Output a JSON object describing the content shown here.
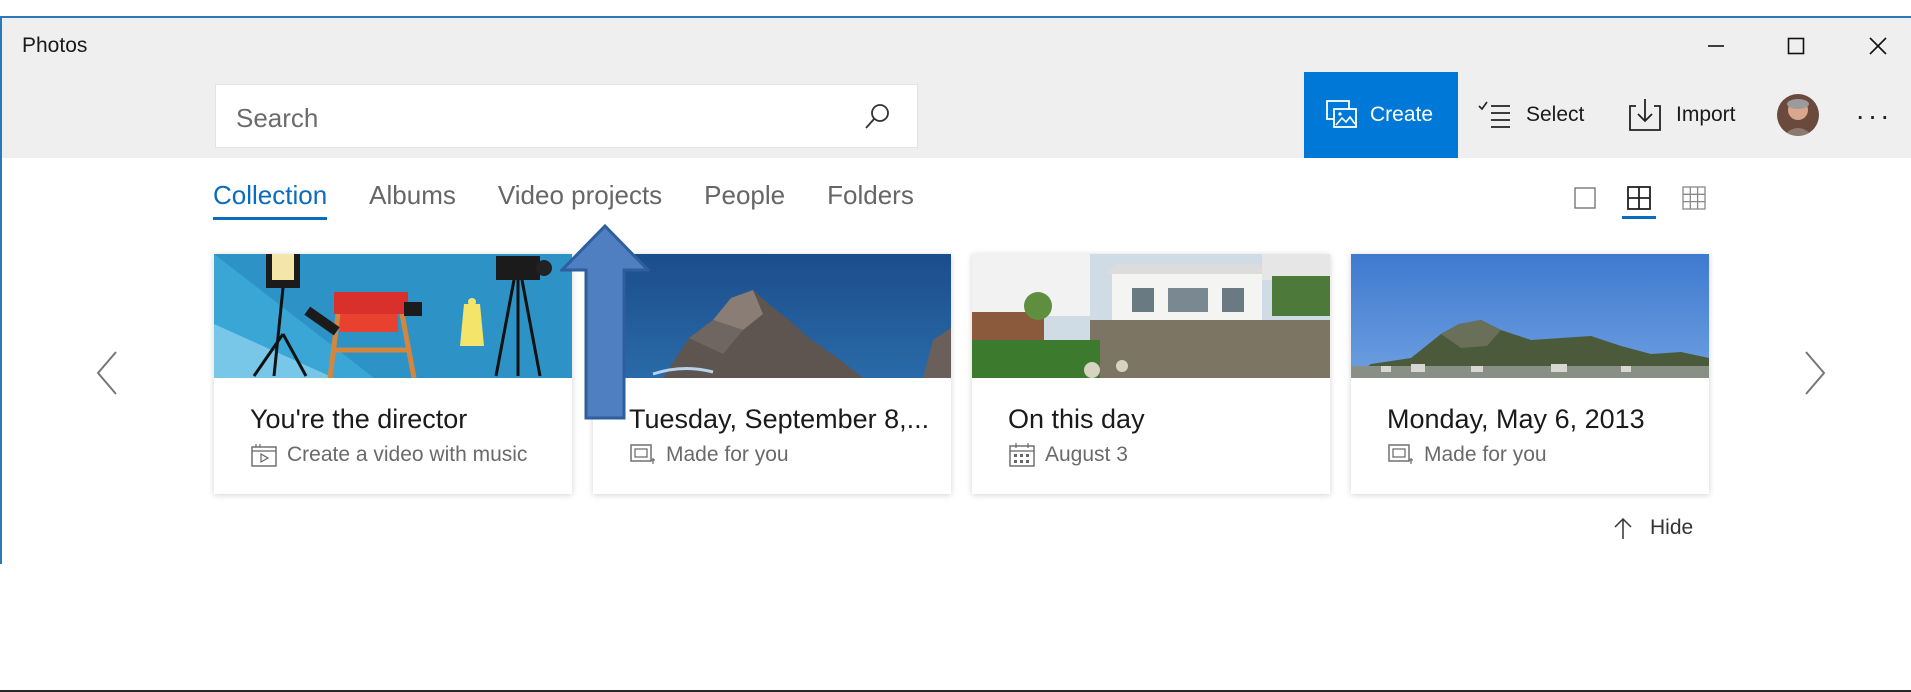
{
  "window": {
    "title": "Photos",
    "controls": {
      "minimize": "minimize-icon",
      "maximize": "maximize-icon",
      "close": "close-icon"
    }
  },
  "search": {
    "placeholder": "Search",
    "icon": "search-icon"
  },
  "toolbar": {
    "create_label": "Create",
    "select_label": "Select",
    "import_label": "Import",
    "more_label": "···"
  },
  "nav": {
    "tabs": [
      {
        "label": "Collection",
        "active": true
      },
      {
        "label": "Albums",
        "active": false
      },
      {
        "label": "Video projects",
        "active": false
      },
      {
        "label": "People",
        "active": false
      },
      {
        "label": "Folders",
        "active": false
      }
    ],
    "view_options": [
      "single-view-icon",
      "medium-grid-icon",
      "small-grid-icon"
    ],
    "selected_view": "medium-grid-icon"
  },
  "cards": [
    {
      "title": "You're the director",
      "subtitle": "Create a video with music",
      "icon": "video-editor-icon"
    },
    {
      "title": "Tuesday, September 8,...",
      "subtitle": "Made for you",
      "icon": "album-icon"
    },
    {
      "title": "On this day",
      "subtitle": "August 3",
      "icon": "calendar-icon"
    },
    {
      "title": "Monday, May 6, 2013",
      "subtitle": "Made for you",
      "icon": "album-icon"
    }
  ],
  "hide_label": "Hide",
  "colors": {
    "accent": "#0078d7",
    "tab_active": "#0b6bbd",
    "annotation_arrow": "#4f7fc1"
  }
}
